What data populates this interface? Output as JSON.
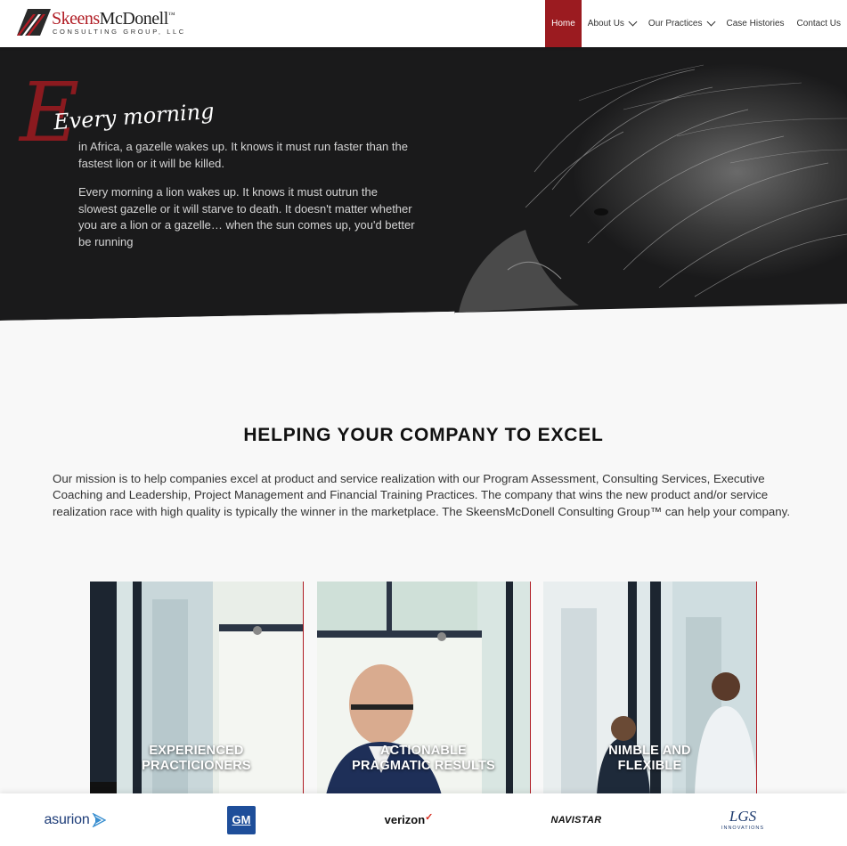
{
  "nav": {
    "logo": {
      "name_red": "Skeens",
      "name_black": "McDonell",
      "tm": "™",
      "sub": "CONSULTING GROUP, LLC"
    },
    "items": [
      {
        "label": "Home",
        "active": true,
        "dropdown": false
      },
      {
        "label": "About Us",
        "active": false,
        "dropdown": true
      },
      {
        "label": "Our Practices",
        "active": false,
        "dropdown": true
      },
      {
        "label": "Case Histories",
        "active": false,
        "dropdown": false
      },
      {
        "label": "Contact Us",
        "active": false,
        "dropdown": false
      }
    ]
  },
  "hero": {
    "script_initial": "E",
    "script_title": "Every morning",
    "paragraph_1": "in Africa, a gazelle wakes up. It knows it must run faster than the fastest lion or it will be killed.",
    "paragraph_2": "Every morning a lion wakes up. It knows it must outrun the slowest gazelle or it will starve to death. It doesn't matter whether you are a lion or a gazelle… when the sun comes up, you'd better be running"
  },
  "main": {
    "headline": "HELPING YOUR COMPANY TO EXCEL",
    "mission": "Our mission is to help companies excel at product and service realization with our Program Assessment, Consulting Services, Executive Coaching and Leadership, Project Management and Financial Training Practices. The company that wins the new product and/or service realization race with high quality is typically the winner in the marketplace. The SkeensMcDonell Consulting Group™ can help your company."
  },
  "cards": [
    {
      "line1": "EXPERIENCED",
      "line2": "PRACTICIONERS"
    },
    {
      "line1": "ACTIONABLE",
      "line2": "PRAGMATIC RESULTS"
    },
    {
      "line1": "NIMBLE AND",
      "line2": "FLEXIBLE"
    }
  ],
  "clients": {
    "asurion": "asurion",
    "gm": "GM",
    "verizon": "verizon",
    "verizon_check": "✓",
    "navistar": "NAVISTAR",
    "lgs": "LGS",
    "lgs_sub": "INNOVATIONS"
  },
  "colors": {
    "brand_red": "#9b1b20",
    "hero_bg": "#1a1a1b",
    "page_bg": "#f8f8f8"
  }
}
